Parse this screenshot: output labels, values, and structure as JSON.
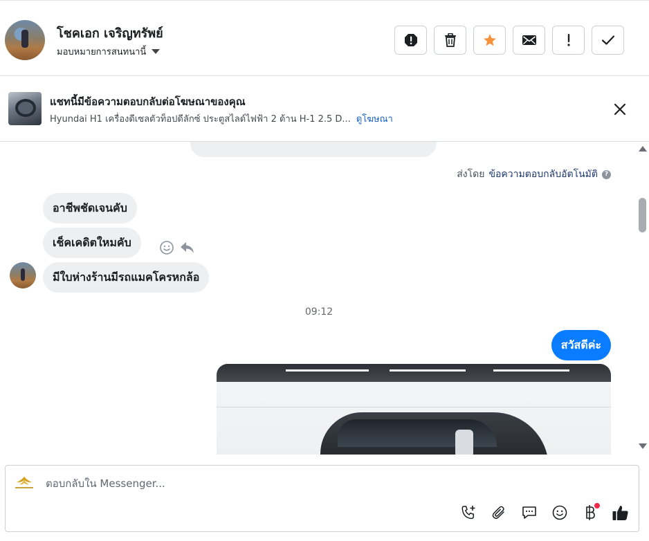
{
  "contact": {
    "name": "โชคเอก เจริญทรัพย์",
    "assign_label": "มอบหมายการสนทนานี้"
  },
  "actions": [
    {
      "name": "spam",
      "icon": "stop-exclamation-icon"
    },
    {
      "name": "delete",
      "icon": "trash-icon"
    },
    {
      "name": "star",
      "icon": "star-icon",
      "color": "#f7923a"
    },
    {
      "name": "mark-unread",
      "icon": "envelope-icon"
    },
    {
      "name": "follow-up",
      "icon": "exclamation-icon"
    },
    {
      "name": "done",
      "icon": "checkmark-icon"
    }
  ],
  "ad_banner": {
    "title": "แชทนี้มีข้อความตอบกลับต่อโฆษณาของคุณ",
    "description": "Hyundai H1 เครื่องดีเซลตัวท็อปดีลักซ์ ประตูสไลด์ไฟฟ้า 2 ด้าน H-1 2.5 D...",
    "link": "ดูโฆษณา"
  },
  "chat": {
    "sent_by_prefix": "ส่งโดย",
    "sent_by_link": "ข้อความตอบกลับอัตโนมัติ",
    "incoming": [
      "อาชีพชัดเจนคับ",
      "เช็คเคดิตใหมคับ",
      "มีใบห่างร้านมีรถแมคโครหกล้อ"
    ],
    "time": "09:12",
    "outgoing": "สวัสดีค่ะ"
  },
  "composer": {
    "placeholder": "ตอบกลับใน Messenger...",
    "tools": [
      "phone-plus-icon",
      "paperclip-icon",
      "chat-bubble-icon",
      "smiley-icon",
      "baht-icon",
      "thumbs-up-icon"
    ]
  },
  "colors": {
    "accent": "#0a7cff",
    "star": "#f7923a",
    "link": "#1762c4",
    "notification": "#f02849"
  }
}
